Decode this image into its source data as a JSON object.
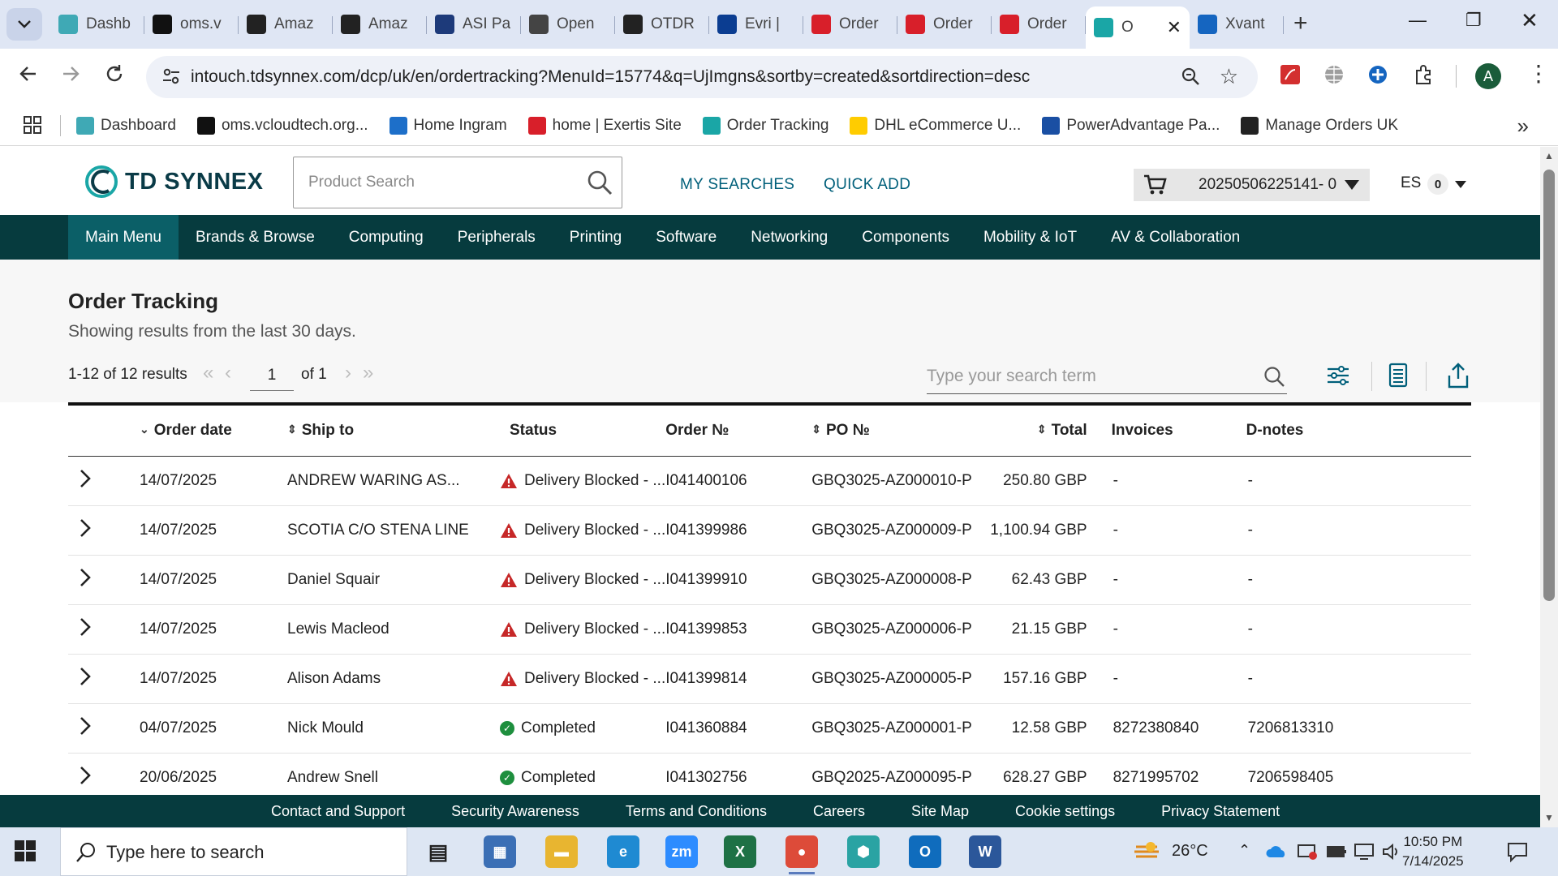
{
  "browser": {
    "tabs": [
      {
        "title": "Dashb",
        "favicon": "dashboard-favicon",
        "color": "#3fa9b5"
      },
      {
        "title": "oms.v",
        "favicon": "oms-favicon",
        "color": "#111111"
      },
      {
        "title": "Amaz",
        "favicon": "amazon-favicon",
        "color": "#222222"
      },
      {
        "title": "Amaz",
        "favicon": "amazon-favicon",
        "color": "#222222"
      },
      {
        "title": "ASI Pa",
        "favicon": "asi-favicon",
        "color": "#1d3a7a"
      },
      {
        "title": "Open",
        "favicon": "openai-favicon",
        "color": "#444444"
      },
      {
        "title": "OTDR",
        "favicon": "openai-favicon",
        "color": "#222222"
      },
      {
        "title": "Evri |",
        "favicon": "evri-favicon",
        "color": "#0b3d91"
      },
      {
        "title": "Order",
        "favicon": "exertis-favicon",
        "color": "#d81f2a"
      },
      {
        "title": "Order",
        "favicon": "exertis-favicon",
        "color": "#d81f2a"
      },
      {
        "title": "Order",
        "favicon": "exertis-favicon",
        "color": "#d81f2a"
      },
      {
        "title": "O",
        "favicon": "tdsynnex-favicon",
        "color": "#1aa6a6",
        "active": true
      },
      {
        "title": "Xvant",
        "favicon": "xvantage-favicon",
        "color": "#1565c0"
      }
    ],
    "url": "intouch.tdsynnex.com/dcp/uk/en/ordertracking?MenuId=15774&q=UjImgns&sortby=created&sortdirection=desc",
    "profile_initial": "A",
    "bookmarks": [
      {
        "label": "Dashboard",
        "favicon": "dashboard-favicon",
        "color": "#3fa9b5"
      },
      {
        "label": "oms.vcloudtech.org...",
        "favicon": "oms-favicon",
        "color": "#111111"
      },
      {
        "label": "Home Ingram",
        "favicon": "ingram-favicon",
        "color": "#1d6fc9"
      },
      {
        "label": "home | Exertis Site",
        "favicon": "exertis-favicon",
        "color": "#d81f2a"
      },
      {
        "label": "Order Tracking",
        "favicon": "tdsynnex-favicon",
        "color": "#1aa6a6"
      },
      {
        "label": "DHL eCommerce U...",
        "favicon": "dhl-favicon",
        "color": "#ffcc00"
      },
      {
        "label": "PowerAdvantage Pa...",
        "favicon": "poweradvantage-favicon",
        "color": "#1a4fa3"
      },
      {
        "label": "Manage Orders UK",
        "favicon": "amazon-favicon",
        "color": "#222222"
      }
    ]
  },
  "header": {
    "logo_text": "TD SYNNEX",
    "search_placeholder": "Product Search",
    "my_searches": "MY SEARCHES",
    "quick_add": "QUICK ADD",
    "cart_number": "20250506225141- 0",
    "lang": "ES",
    "lang_count": "0"
  },
  "nav": {
    "items": [
      "Main Menu",
      "Brands & Browse",
      "Computing",
      "Peripherals",
      "Printing",
      "Software",
      "Networking",
      "Components",
      "Mobility & IoT",
      "AV & Collaboration"
    ]
  },
  "orders": {
    "title": "Order Tracking",
    "subtitle": "Showing results from the last 30 days.",
    "results_text": "1-12 of 12 results",
    "page": "1",
    "of_pages": "of 1",
    "search_placeholder": "Type your search term",
    "columns": {
      "order_date": "Order date",
      "ship_to": "Ship to",
      "status": "Status",
      "order_no": "Order №",
      "po_no": "PO №",
      "total": "Total",
      "invoices": "Invoices",
      "dnotes": "D-notes"
    },
    "rows": [
      {
        "date": "14/07/2025",
        "ship_to": "ANDREW WARING AS...",
        "status": "Delivery Blocked - ...",
        "status_type": "warning",
        "order_no": "I041400106",
        "po_no": "GBQ3025-AZ000010-P",
        "total": "250.80 GBP",
        "invoice": "-",
        "dnote": "-"
      },
      {
        "date": "14/07/2025",
        "ship_to": "SCOTIA C/O STENA LINE",
        "status": "Delivery Blocked - ...",
        "status_type": "warning",
        "order_no": "I041399986",
        "po_no": "GBQ3025-AZ000009-P",
        "total": "1,100.94 GBP",
        "invoice": "-",
        "dnote": "-"
      },
      {
        "date": "14/07/2025",
        "ship_to": "Daniel Squair",
        "status": "Delivery Blocked - ...",
        "status_type": "warning",
        "order_no": "I041399910",
        "po_no": "GBQ3025-AZ000008-P",
        "total": "62.43 GBP",
        "invoice": "-",
        "dnote": "-"
      },
      {
        "date": "14/07/2025",
        "ship_to": "Lewis Macleod",
        "status": "Delivery Blocked - ...",
        "status_type": "warning",
        "order_no": "I041399853",
        "po_no": "GBQ3025-AZ000006-P",
        "total": "21.15 GBP",
        "invoice": "-",
        "dnote": "-"
      },
      {
        "date": "14/07/2025",
        "ship_to": "Alison Adams",
        "status": "Delivery Blocked - ...",
        "status_type": "warning",
        "order_no": "I041399814",
        "po_no": "GBQ3025-AZ000005-P",
        "total": "157.16 GBP",
        "invoice": "-",
        "dnote": "-"
      },
      {
        "date": "04/07/2025",
        "ship_to": "Nick Mould",
        "status": "Completed",
        "status_type": "ok",
        "order_no": "I041360884",
        "po_no": "GBQ3025-AZ000001-P",
        "total": "12.58 GBP",
        "invoice": "8272380840",
        "dnote": "7206813310"
      },
      {
        "date": "20/06/2025",
        "ship_to": "Andrew Snell",
        "status": "Completed",
        "status_type": "ok",
        "order_no": "I041302756",
        "po_no": "GBQ2025-AZ000095-P",
        "total": "628.27 GBP",
        "invoice": "8271995702",
        "dnote": "7206598405"
      }
    ]
  },
  "footer": {
    "links": [
      "Contact and Support",
      "Security Awareness",
      "Terms and Conditions",
      "Careers",
      "Site Map",
      "Cookie settings",
      "Privacy Statement"
    ]
  },
  "taskbar": {
    "search_placeholder": "Type here to search",
    "temperature": "26°C",
    "time": "10:50 PM",
    "date": "7/14/2025",
    "apps": [
      {
        "name": "task-view-icon",
        "color": "#dde6f3"
      },
      {
        "name": "calculator-icon",
        "color": "#3b6fb5"
      },
      {
        "name": "file-explorer-icon",
        "color": "#e8b530"
      },
      {
        "name": "edge-icon",
        "color": "#1f8ad2"
      },
      {
        "name": "zoom-icon",
        "color": "#2d8cff"
      },
      {
        "name": "excel-icon",
        "color": "#1e7145"
      },
      {
        "name": "chrome-icon",
        "color": "#dd4b39"
      },
      {
        "name": "teams-hexagon-icon",
        "color": "#2aa3a3"
      },
      {
        "name": "outlook-icon",
        "color": "#0f6cbd"
      },
      {
        "name": "word-icon",
        "color": "#2b579a"
      }
    ]
  },
  "colors": {
    "brand_dark": "#063b3e",
    "brand_active": "#0b5f67",
    "link": "#00677f",
    "warning": "#c62828",
    "success": "#1e8f3e"
  }
}
